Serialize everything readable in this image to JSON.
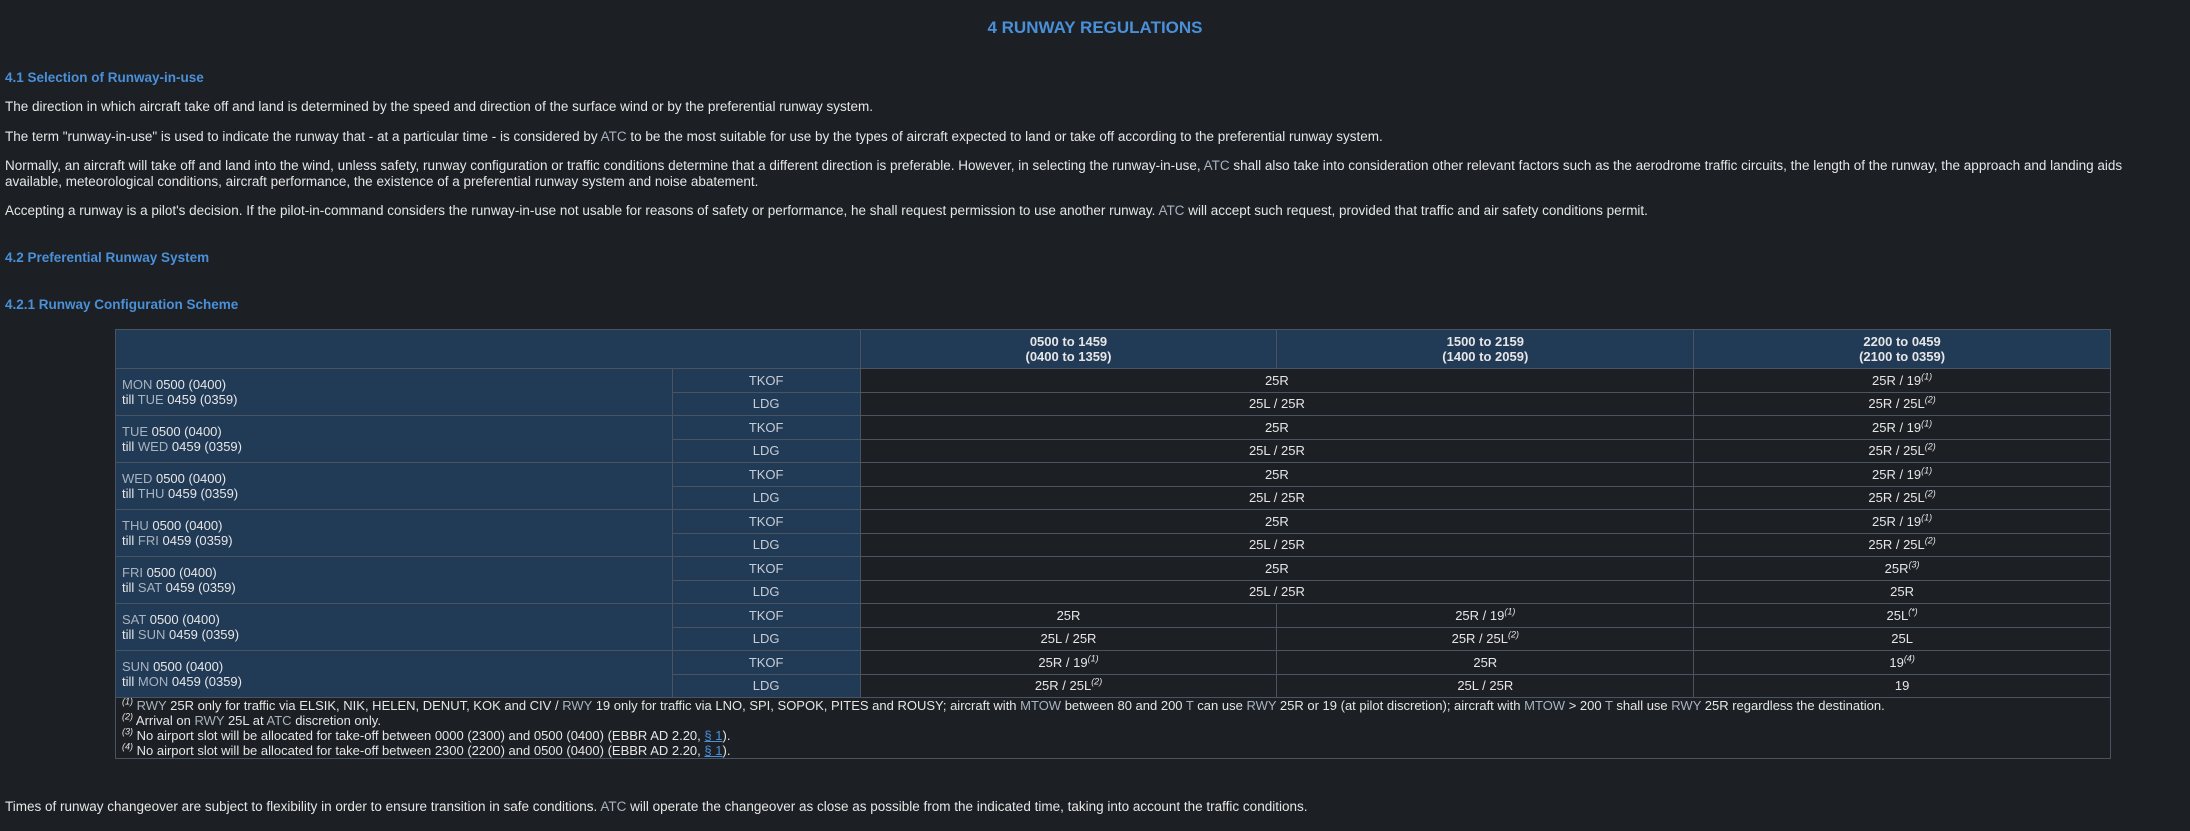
{
  "title": "4   RUNWAY REGULATIONS",
  "s41": {
    "heading": "4.1   Selection of Runway-in-use",
    "p1": "The direction in which aircraft take off and land is determined by the speed and direction of the surface wind or by the preferential runway system.",
    "p2": {
      "a": "The term \"runway-in-use\" is used to indicate the runway that - at a particular time - is considered by",
      "atc": "ATC",
      "b": "to be the most suitable for use by the types of aircraft expected to land or take off according to the preferential runway system."
    },
    "p3": {
      "a": "Normally, an aircraft will take off and land into the wind, unless safety, runway configuration or traffic conditions determine that a different direction is preferable. However, in selecting the runway-in-use,",
      "atc": "ATC",
      "b": "shall also take into consideration other relevant factors such as the aerodrome traffic circuits, the length of the runway, the approach and landing aids available, meteorological conditions, aircraft performance, the existence of a preferential runway system and noise abatement."
    },
    "p4": {
      "a": "Accepting a runway is a pilot's decision. If the pilot-in-command considers the runway-in-use not usable for reasons of safety or performance, he shall request permission to use another runway.",
      "atc": "ATC",
      "b": "will accept such request, provided that traffic and air safety conditions permit."
    }
  },
  "s42": {
    "heading": "4.2   Preferential Runway System"
  },
  "s421": {
    "heading": "4.2.1   Runway Configuration Scheme"
  },
  "table": {
    "headers": [
      {
        "l1": "0500 to 1459",
        "l2": "(0400 to 1359)"
      },
      {
        "l1": "1500 to 2159",
        "l2": "(1400 to 2059)"
      },
      {
        "l1": "2200 to 0459",
        "l2": "(2100 to 0359)"
      }
    ],
    "till": "till",
    "tkof": "TKOF",
    "ldg": "LDG",
    "time_from": "0500 (0400)",
    "time_to": "0459 (0359)",
    "days": [
      "MON",
      "TUE",
      "WED",
      "THU",
      "FRI",
      "SAT",
      "SUN"
    ],
    "next_days": [
      "TUE",
      "WED",
      "THU",
      "FRI",
      "SAT",
      "SUN",
      "MON"
    ],
    "weekday_tkof": "25R",
    "weekday_ldg": "25L / 25R",
    "night_tkof": "25R / 19",
    "night_ldg": "25R / 25L",
    "fri_night_tkof": "25R",
    "fri_night_ldg": "25R",
    "sat": {
      "tkof1": "25R",
      "ldg1": "25L / 25R",
      "tkof2": "25R / 19",
      "ldg2": "25R / 25L",
      "tkof3": "25L",
      "ldg3": "25L"
    },
    "sun": {
      "tkof1": "25R / 19",
      "ldg1": "25R / 25L",
      "tkof2": "25R",
      "ldg2": "25L / 25R",
      "tkof3": "19",
      "ldg3": "19"
    },
    "sup": {
      "n1": "(1)",
      "n2": "(2)",
      "n3": "(3)",
      "n4": "(4)",
      "na": "(*)"
    }
  },
  "notes": {
    "n1": {
      "rwy1": "RWY",
      "a": "25R only for traffic via ELSIK, NIK, HELEN, DENUT, KOK and CIV /",
      "rwy2": "RWY",
      "b": "19 only for traffic via LNO, SPI, SOPOK, PITES and ROUSY; aircraft with",
      "mtow1": "MTOW",
      "c": "between 80 and 200",
      "t1": "T",
      "d": "can use",
      "rwy3": "RWY",
      "e": "25R or 19 (at pilot discretion); aircraft with",
      "mtow2": "MTOW",
      "f": "> 200",
      "t2": "T",
      "g": "shall use",
      "rwy4": "RWY",
      "h": "25R regardless the destination."
    },
    "n2": {
      "a": "Arrival on",
      "rwy": "RWY",
      "b": "25L at",
      "atc": "ATC",
      "c": "discretion only."
    },
    "n3": {
      "a": "No airport slot will be allocated for take-off between 0000 (2300) and 0500 (0400) (EBBR AD 2.20,",
      "link": "§ 1",
      "b": ")."
    },
    "n4": {
      "a": "No airport slot will be allocated for take-off between 2300 (2200) and 0500 (0400) (EBBR AD 2.20,",
      "link": "§ 1",
      "b": ")."
    }
  },
  "footer": {
    "a": "Times of runway changeover are subject to flexibility in order to ensure transition in safe conditions.",
    "atc": "ATC",
    "b": "will operate the changeover as close as possible from the indicated time, taking into account the traffic conditions."
  }
}
